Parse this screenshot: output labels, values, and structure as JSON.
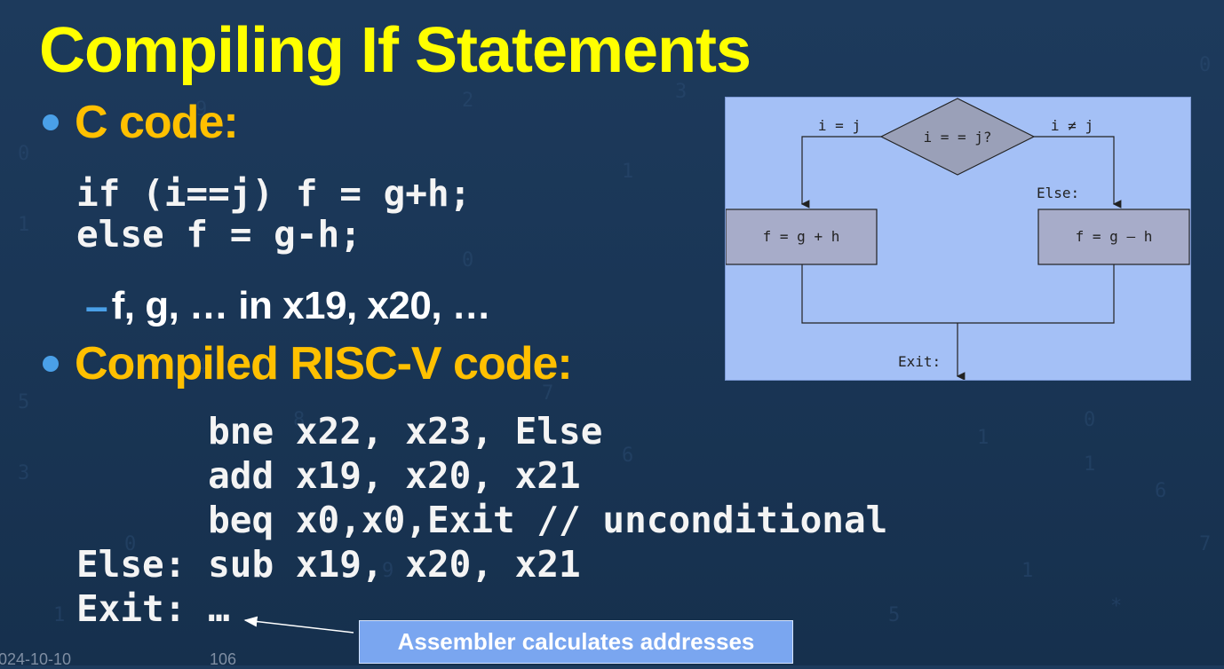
{
  "slide": {
    "title": "Compiling If Statements",
    "bullet1": "C code:",
    "c_code_line1": "if (i==j) f = g+h;",
    "c_code_line2": "else f = g-h;",
    "sub_bullet": "f, g, … in x19, x20, …",
    "bullet2": "Compiled RISC-V code:",
    "asm_lines": [
      "      bne x22, x23, Else",
      "      add x19, x20, x21",
      "      beq x0,x0,Exit // unconditional",
      "Else: sub x19, x20, x21",
      "Exit: …"
    ],
    "callout": "Assembler calculates addresses",
    "footer_date": "024-10-10",
    "footer_page": "106"
  },
  "diagram": {
    "decision": "i = = j?",
    "left_edge": "i = j",
    "right_edge": "i ≠ j",
    "else_label": "Else:",
    "left_box": "f = g + h",
    "right_box": "f = g – h",
    "exit_label": "Exit:"
  },
  "colors": {
    "title": "#ffff00",
    "bullet_text": "#ffc000",
    "bullet_dot": "#4aa0e8",
    "code_text": "#f4f4f4",
    "diagram_bg": "#a4c0f6",
    "diagram_box": "#a7acc9",
    "callout_bg": "#7aa6f0"
  }
}
